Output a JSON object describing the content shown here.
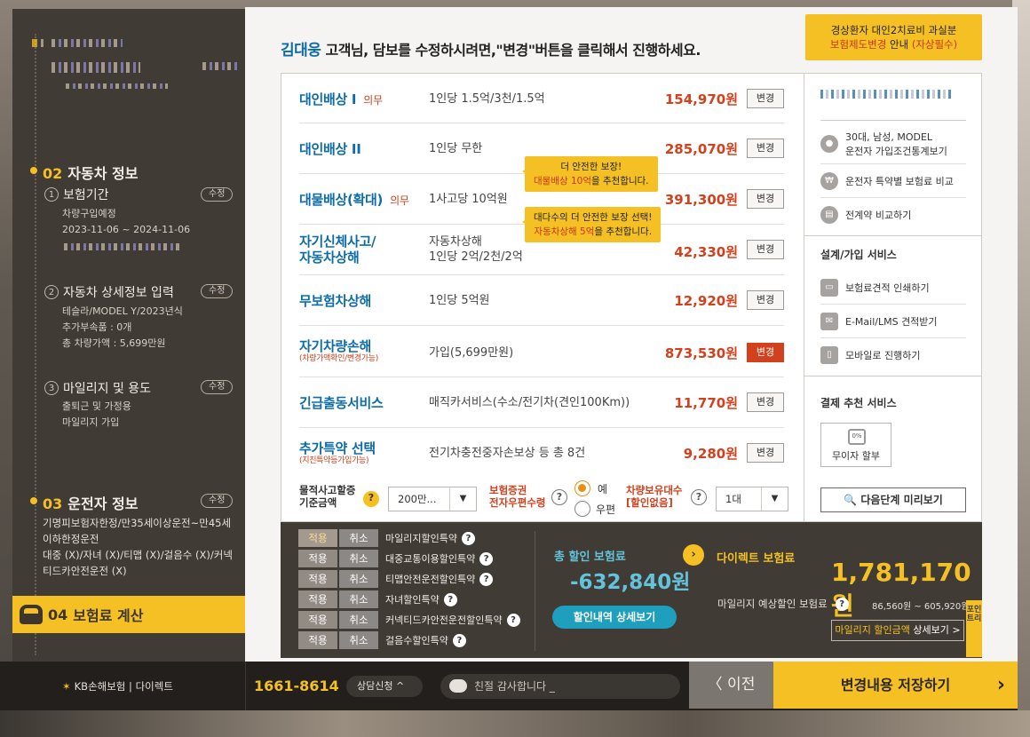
{
  "sidebar": {
    "sections": [
      {
        "num": "02",
        "title": "자동차 정보"
      },
      {
        "num": "03",
        "title": "운전자 정보"
      },
      {
        "num": "04",
        "title": "보험료 계산"
      }
    ],
    "edit_label": "수정",
    "sub": [
      {
        "num": "1",
        "title": "보험기간",
        "lines": [
          "차량구입예정",
          "2023-11-06 ~ 2024-11-06"
        ]
      },
      {
        "num": "2",
        "title": "자동차 상세정보 입력",
        "lines": [
          "테슬라/MODEL Y/2023년식",
          "추가부속품 : 0개",
          "총 차량가액 : 5,699만원"
        ]
      },
      {
        "num": "3",
        "title": "마일리지 및 용도",
        "lines": [
          "출퇴근 및 가정용",
          "마일리지 가입"
        ]
      }
    ],
    "driver_info": [
      "기명피보험자한정/만35세이상운전~만45세이하한정운전",
      "대중 (X)/자녀 (X)/티맵 (X)/걸음수 (X)/커넥티드카안전운전 (X)"
    ]
  },
  "header": {
    "name": "김대웅",
    "text": " 고객님, 담보를 수정하시려면,\"변경\"버튼을 클릭해서 진행하세요.",
    "notice_line1": "경상환자 대인2치료비 과실분",
    "notice_red1": "보험제도변경",
    "notice_mid": " 안내 ",
    "notice_red2": "(자상필수)"
  },
  "coverages": [
    {
      "name": "대인배상 I",
      "must": "의무",
      "desc": "1인당 1.5억/3천/1.5억",
      "price": "154,970원"
    },
    {
      "name": "대인배상 II",
      "must": "",
      "desc": "1인당 무한",
      "price": "285,070원"
    },
    {
      "name": "대물배상(확대)",
      "must": "의무",
      "desc": "1사고당 10억원",
      "price": "391,300원"
    },
    {
      "name": "자기신체사고/",
      "name2": "자동차상해",
      "must": "",
      "desc": "자동차상해",
      "desc2": "1인당 2억/2천/2억",
      "price": "42,330원"
    },
    {
      "name": "무보험차상해",
      "must": "",
      "desc": "1인당 5억원",
      "price": "12,920원"
    },
    {
      "name": "자기차량손해",
      "note": "(차량가액확인/변경가능)",
      "must": "",
      "desc": "가입(5,699만원)",
      "price": "873,530원"
    },
    {
      "name": "긴급출동서비스",
      "must": "",
      "desc": "매직카서비스(수소/전기차(견인100Km))",
      "price": "11,770원"
    },
    {
      "name": "추가특약 선택",
      "note": "(지진특약등가입가능)",
      "must": "",
      "desc": "전기차충전중자손보상 등 총 8건",
      "price": "9,280원"
    }
  ],
  "change_label": "변경",
  "tips": {
    "tip1_line1": "더 안전한 보장!",
    "tip1_red": "대물배상 10억",
    "tip1_rest": "을 추천합니다.",
    "tip2_line1": "대다수의 더 안전한 보장 선택!",
    "tip2_red": "자동차상해 5억",
    "tip2_rest": "을 추천합니다."
  },
  "options": {
    "property_label1": "물적사고할증",
    "property_label2": "기준금액",
    "property_value": "200만...",
    "cert_label1": "보험증권",
    "cert_label2": "전자우편수령",
    "yes": "예",
    "no": "우편",
    "vehicle_label1": "차량보유대수",
    "vehicle_label2": "[할인없음]",
    "vehicle_value": "1대"
  },
  "right": {
    "profile": "30대, 남성, MODEL",
    "profile2": "운전자 가입조건통계보기",
    "compare1": "운전자 특약별 보험료 비교",
    "compare2": "전계약 비교하기",
    "svc_title": "설계/가입 서비스",
    "print": "보험료견적 인쇄하기",
    "email": "E-Mail/LMS 견적받기",
    "mobile": "모바일로 진행하기",
    "pay_title": "결제 추천 서비스",
    "noint": "무이자 할부",
    "noint_ico": "0%",
    "preview": "다음단계 미리보기"
  },
  "discounts": {
    "apply": "적용",
    "cancel": "취소",
    "items": [
      "마일리지할인특약",
      "대중교통이용할인특약",
      "티맵안전운전할인특약",
      "자녀할인특약",
      "커넥티드카안전운전할인특약",
      "걸음수할인특약"
    ],
    "total_label": "총 할인 보험료",
    "total_value": "-632,840원",
    "detail_btn": "할인내역 상세보기",
    "direct_label": "다이렉트 보험료",
    "direct_value": "1,781,170원",
    "mileage_label": "마일리지 예상할인 보험료",
    "mileage_value": "86,560원 ~ 605,920원",
    "mileage_btn_y": "마일리지 할인금액",
    "mileage_btn_rest": " 상세보기 >",
    "point": "포인트리"
  },
  "footer": {
    "logo": "KB손해보험",
    "logo2": " | 다이렉트",
    "phone": "1661-8614",
    "consult": "상담신청 ^",
    "chat": "친절 감사합니다 _",
    "prev": "〈 이전",
    "save": "변경내용 저장하기"
  }
}
